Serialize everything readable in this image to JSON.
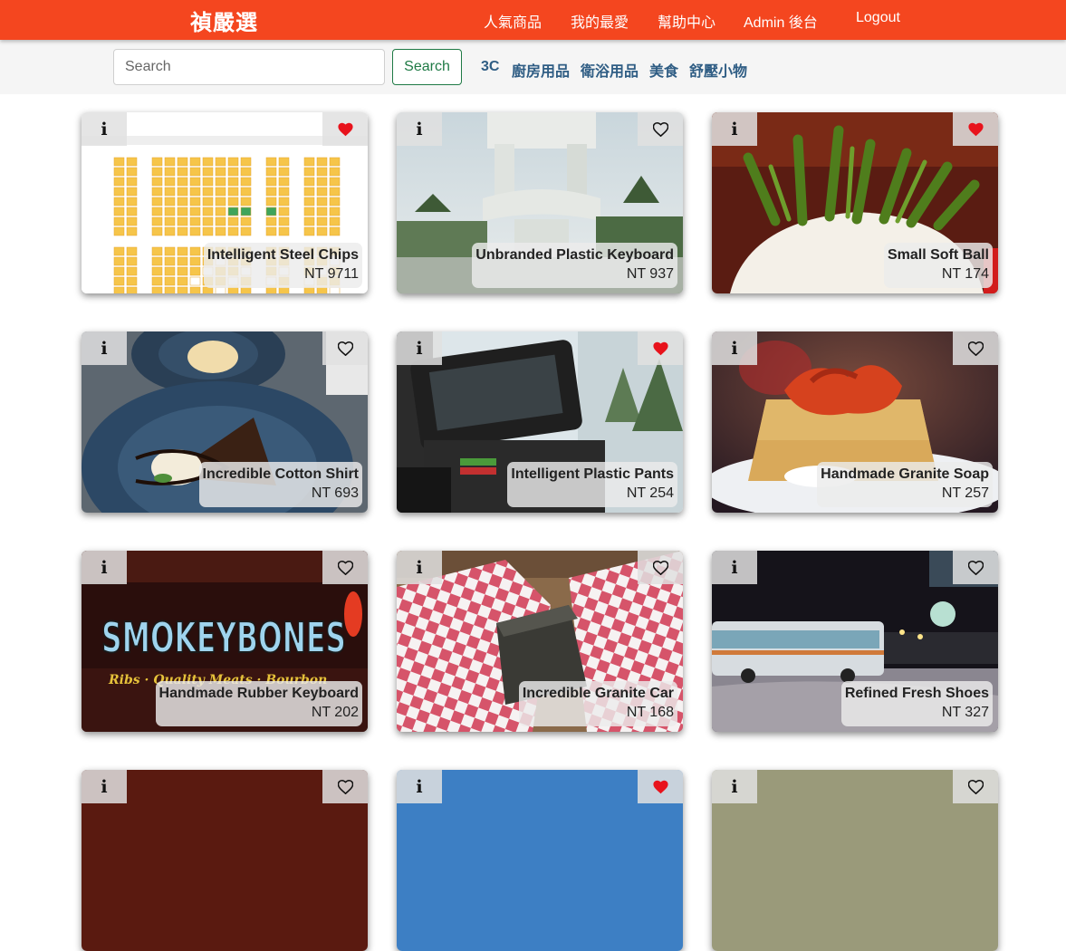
{
  "navbar": {
    "brand": "禎嚴選",
    "links": [
      "人氣商品",
      "我的最愛",
      "幫助中心",
      "Admin 後台",
      "Logout"
    ]
  },
  "search": {
    "placeholder": "Search",
    "value": "",
    "button_label": "Search"
  },
  "categories": [
    "3C",
    "廚房用品",
    "衛浴用品",
    "美食",
    "舒壓小物"
  ],
  "icons": {
    "info": "info-icon",
    "favorite_filled": "heart-filled-icon",
    "favorite_outline": "heart-outline-icon"
  },
  "colors": {
    "brand": "#f4461f",
    "heart": "#e8131c",
    "search_button": "#1f7a45",
    "category_link": "#2f5d84"
  },
  "info_glyph": "i",
  "products": [
    {
      "name": "Intelligent Steel Chips",
      "price": "NT 9711",
      "favorited": true
    },
    {
      "name": "Unbranded Plastic Keyboard",
      "price": "NT 937",
      "favorited": false
    },
    {
      "name": "Small Soft Ball",
      "price": "NT 174",
      "favorited": true
    },
    {
      "name": "Incredible Cotton Shirt",
      "price": "NT 693",
      "favorited": false
    },
    {
      "name": "Intelligent Plastic Pants",
      "price": "NT 254",
      "favorited": true
    },
    {
      "name": "Handmade Granite Soap",
      "price": "NT 257",
      "favorited": false
    },
    {
      "name": "Handmade Rubber Keyboard",
      "price": "NT 202",
      "favorited": false
    },
    {
      "name": "Incredible Granite Car",
      "price": "NT 168",
      "favorited": false
    },
    {
      "name": "Refined Fresh Shoes",
      "price": "NT 327",
      "favorited": false
    }
  ],
  "partial_row": [
    {
      "favorited": false
    },
    {
      "favorited": true
    },
    {
      "favorited": false
    }
  ],
  "image_texts": {
    "sign_main": "SMOKEYBONES",
    "sign_sub": "Ribs · Quality Meats · Bourbon"
  }
}
